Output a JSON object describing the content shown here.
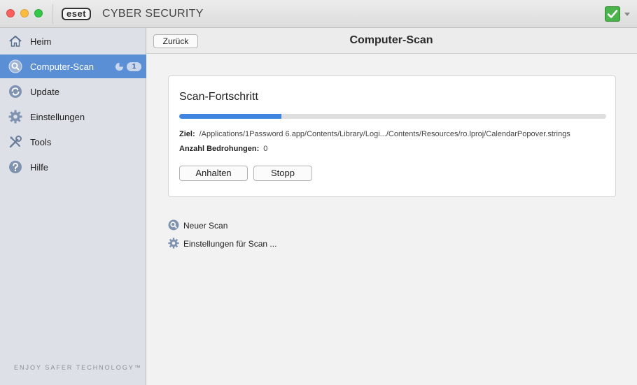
{
  "app": {
    "brand": "eset",
    "title": "CYBER SECURITY"
  },
  "sidebar": {
    "items": [
      {
        "label": "Heim",
        "icon": "home-icon"
      },
      {
        "label": "Computer-Scan",
        "icon": "magnifier-icon",
        "badge": "1"
      },
      {
        "label": "Update",
        "icon": "update-icon"
      },
      {
        "label": "Einstellungen",
        "icon": "gear-icon"
      },
      {
        "label": "Tools",
        "icon": "tools-icon"
      },
      {
        "label": "Hilfe",
        "icon": "help-icon"
      }
    ],
    "tagline": "ENJOY SAFER TECHNOLOGY™"
  },
  "header": {
    "back_label": "Zurück",
    "title": "Computer-Scan"
  },
  "scan": {
    "title": "Scan-Fortschritt",
    "progress_fraction": 0.24,
    "target_label": "Ziel:",
    "target_value": "/Applications/1Password 6.app/Contents/Library/Logi.../Contents/Resources/ro.lproj/CalendarPopover.strings",
    "threats_label": "Anzahl Bedrohungen:",
    "threats_value": "0",
    "pause_label": "Anhalten",
    "stop_label": "Stopp"
  },
  "links": {
    "new_scan": "Neuer Scan",
    "scan_settings": "Einstellungen für Scan ..."
  },
  "colors": {
    "accent": "#5b8fd5",
    "progress": "#3d85e0",
    "status_ok": "#4bb34b"
  }
}
